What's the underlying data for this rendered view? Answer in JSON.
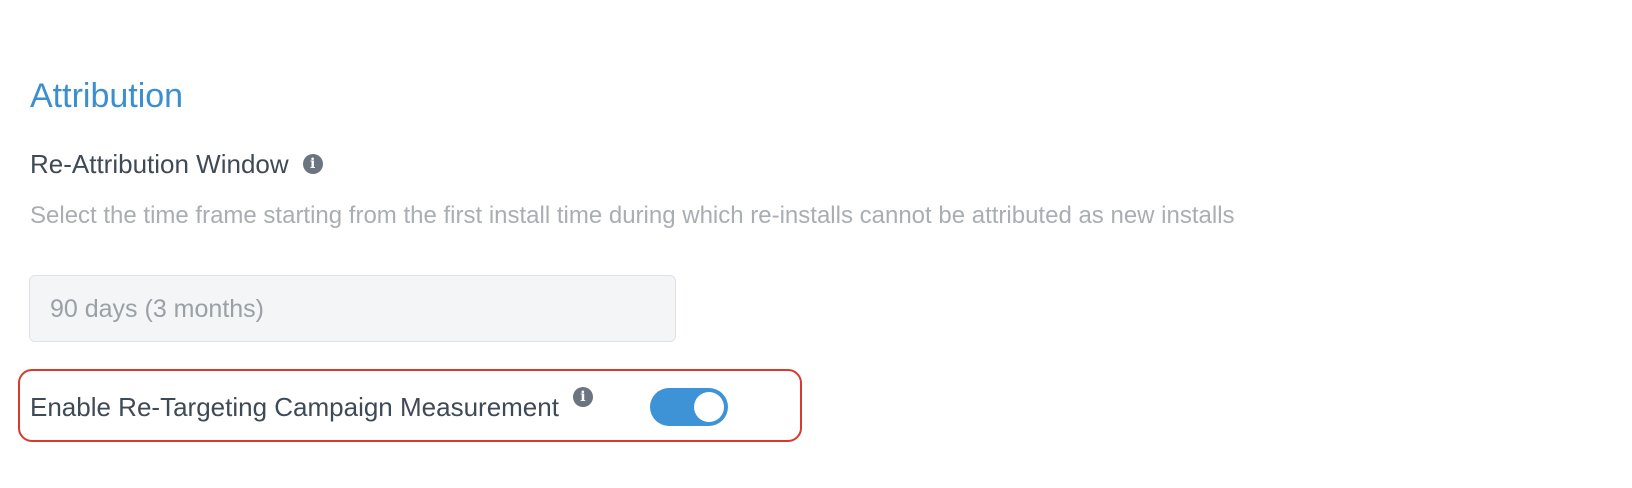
{
  "section": {
    "title": "Attribution"
  },
  "reattribution": {
    "label": "Re-Attribution Window",
    "info_icon": "info-icon",
    "description": "Select the time frame starting from the first install time during which re-installs cannot be attributed as new installs",
    "selected_value": "90 days (3 months)"
  },
  "retargeting": {
    "label": "Enable Re-Targeting Campaign Measurement",
    "info_icon": "info-icon",
    "enabled": true
  },
  "colors": {
    "accent": "#3b8fd0",
    "toggle_on": "#3d93d5",
    "highlight_border": "#d83a2c"
  }
}
